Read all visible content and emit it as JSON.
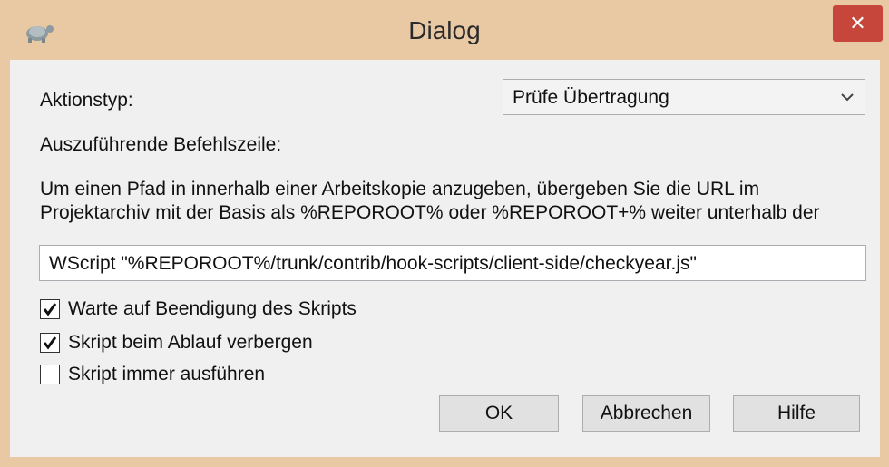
{
  "window": {
    "title": "Dialog"
  },
  "form": {
    "action_type_label": "Aktionstyp:",
    "action_type_value": "Prüfe Übertragung",
    "command_line_label": "Auszuführende Befehlszeile:",
    "info_line1": "Um einen Pfad in innerhalb einer Arbeitskopie anzugeben, übergeben Sie die URL im",
    "info_line2": "Projektarchiv mit der Basis als %REPOROOT% oder %REPOROOT+% weiter unterhalb der",
    "command_value": "WScript \"%REPOROOT%/trunk/contrib/hook-scripts/client-side/checkyear.js\"",
    "checkboxes": [
      {
        "label": "Warte auf Beendigung des Skripts",
        "checked": true
      },
      {
        "label": "Skript beim Ablauf verbergen",
        "checked": true
      },
      {
        "label": "Skript immer ausführen",
        "checked": false
      }
    ]
  },
  "buttons": {
    "ok": "OK",
    "cancel": "Abbrechen",
    "help": "Hilfe"
  },
  "colors": {
    "frame": "#e9c9a3",
    "close": "#c7463c",
    "client": "#f0f0f0"
  },
  "icons": {
    "app": "tortoise-icon",
    "close": "close-icon",
    "dropdown": "chevron-down-icon",
    "check": "checkmark-icon"
  }
}
